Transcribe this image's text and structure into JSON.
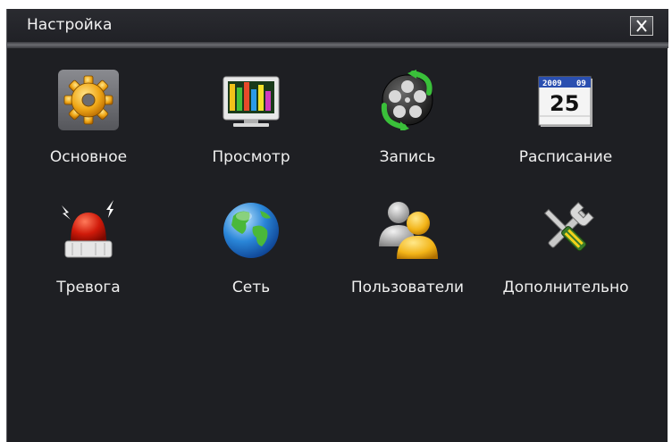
{
  "window": {
    "title": "Настройка",
    "close_label": "close"
  },
  "menu": {
    "items": [
      {
        "label": "Основное",
        "icon": "gear-icon",
        "selected": true
      },
      {
        "label": "Просмотр",
        "icon": "monitor-icon"
      },
      {
        "label": "Запись",
        "icon": "film-reel-icon"
      },
      {
        "label": "Расписание",
        "icon": "calendar-icon",
        "icon_text_year": "2009",
        "icon_text_month": "09",
        "icon_text_day": "25"
      },
      {
        "label": "Тревога",
        "icon": "alarm-siren-icon"
      },
      {
        "label": "Сеть",
        "icon": "globe-icon"
      },
      {
        "label": "Пользователи",
        "icon": "users-icon"
      },
      {
        "label": "Дополнительно",
        "icon": "tools-icon"
      }
    ]
  },
  "colors": {
    "background": "#1e1f23",
    "text": "#f0f0f0",
    "selection": "#6a6b70"
  }
}
